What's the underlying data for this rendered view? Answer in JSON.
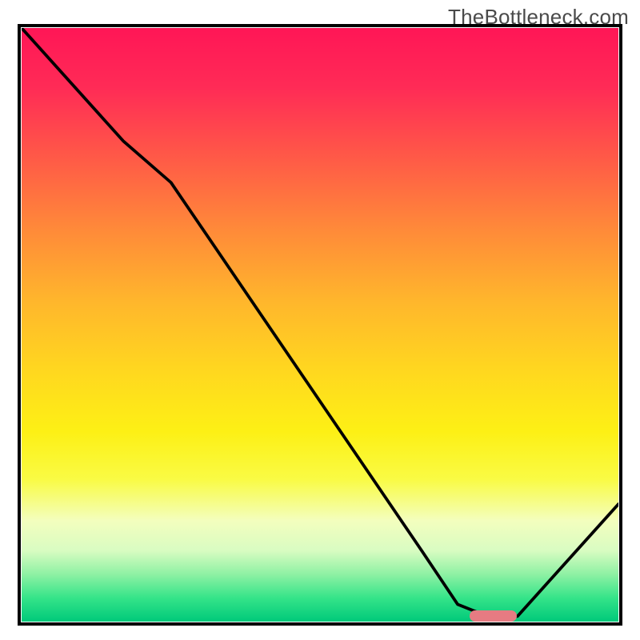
{
  "watermark": "TheBottleneck.com",
  "chart_data": {
    "type": "line",
    "title": "",
    "xlabel": "",
    "ylabel": "",
    "xlim": [
      0,
      100
    ],
    "ylim": [
      0,
      100
    ],
    "x": [
      0,
      17,
      25,
      67,
      73,
      78,
      83,
      100
    ],
    "values": [
      100,
      81,
      74,
      12,
      3,
      1,
      1,
      20
    ],
    "annotations": [
      {
        "label": "optimal-marker",
        "x": 79,
        "y": 1,
        "width_pct": 8
      }
    ],
    "gradient_stops": [
      {
        "pct": 0,
        "color": "#ff1656"
      },
      {
        "pct": 50,
        "color": "#ffd81f"
      },
      {
        "pct": 80,
        "color": "#f9fb44"
      },
      {
        "pct": 100,
        "color": "#00c97a"
      }
    ]
  }
}
